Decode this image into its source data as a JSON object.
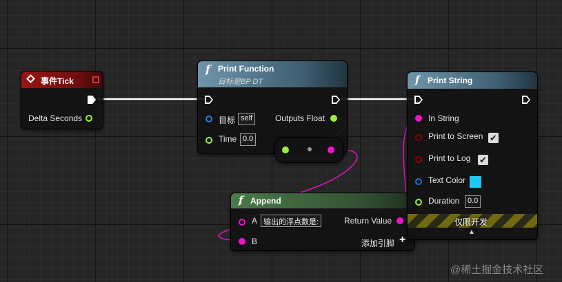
{
  "colors": {
    "exec": "#ffffff",
    "float": "#9bef44",
    "string": "#f014c9",
    "boolean": "#8d0000",
    "object": "#1f7fe4",
    "color": "#1f72e0",
    "event_header": "#8a1010",
    "function_header": "#5a8096",
    "append_header": "#3f6a3f",
    "text_color_swatch": "#1ec6f0",
    "hazard_yellow": "#6f6a10"
  },
  "event_tick": {
    "title": "事件Tick",
    "icon": "event-diamond-icon",
    "output_label": "Delta Seconds"
  },
  "print_function": {
    "title": "Print Function",
    "subtitle": "目标是BP DT",
    "icon": "function-icon",
    "target_label": "目标",
    "target_value": "self",
    "time_label": "Time",
    "time_value": "0.0",
    "output_label": "Outputs Float"
  },
  "reroute": {
    "dot": "•"
  },
  "append": {
    "title": "Append",
    "icon": "function-icon",
    "a_label": "A",
    "a_value": "输出的浮点数是:",
    "b_label": "B",
    "return_label": "Return Value",
    "add_pin_label": "添加引脚",
    "add_pin_icon": "+"
  },
  "print_string": {
    "title": "Print String",
    "icon": "function-icon",
    "in_string_label": "In String",
    "print_to_screen_label": "Print to Screen",
    "print_to_screen_checked": true,
    "print_to_log_label": "Print to Log",
    "print_to_log_checked": true,
    "text_color_label": "Text Color",
    "duration_label": "Duration",
    "duration_value": "0.0",
    "dev_only_label": "仅限开发",
    "expand_arrow": "▲",
    "check_glyph": "✔"
  },
  "watermark": "@稀土掘金技术社区"
}
